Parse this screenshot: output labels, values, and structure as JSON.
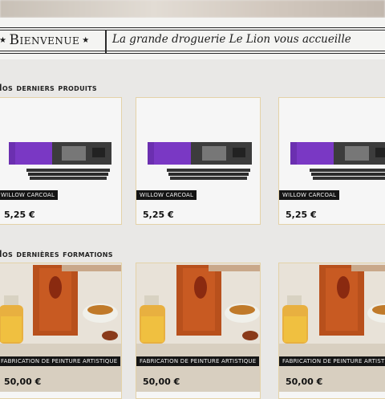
{
  "banner": {
    "welcome": "Bienvenue",
    "tagline": "La grande droguerie Le Lion vous accueille"
  },
  "sections": {
    "products_title": "Nos derniers produits",
    "courses_title": "Nos dernières formations"
  },
  "products": [
    {
      "name": "WILLOW CARCOAL",
      "price": "5,25 €"
    },
    {
      "name": "WILLOW CARCOAL",
      "price": "5,25 €"
    },
    {
      "name": "WILLOW CARCOAL",
      "price": "5,25 €"
    }
  ],
  "courses": [
    {
      "name": "FABRICATION DE PEINTURE ARTISTIQUE",
      "price": "50,00 €"
    },
    {
      "name": "FABRICATION DE PEINTURE ARTISTIQUE",
      "price": "50,00 €"
    },
    {
      "name": "FABRICATION DE PEINTURE ARTISTIQUE",
      "price": "50,00 €"
    }
  ],
  "colors": {
    "background": "#e9e8e6",
    "card_border": "#e4d2a8",
    "tag_bg": "#151515",
    "box_purple": "#6b2fb0"
  }
}
